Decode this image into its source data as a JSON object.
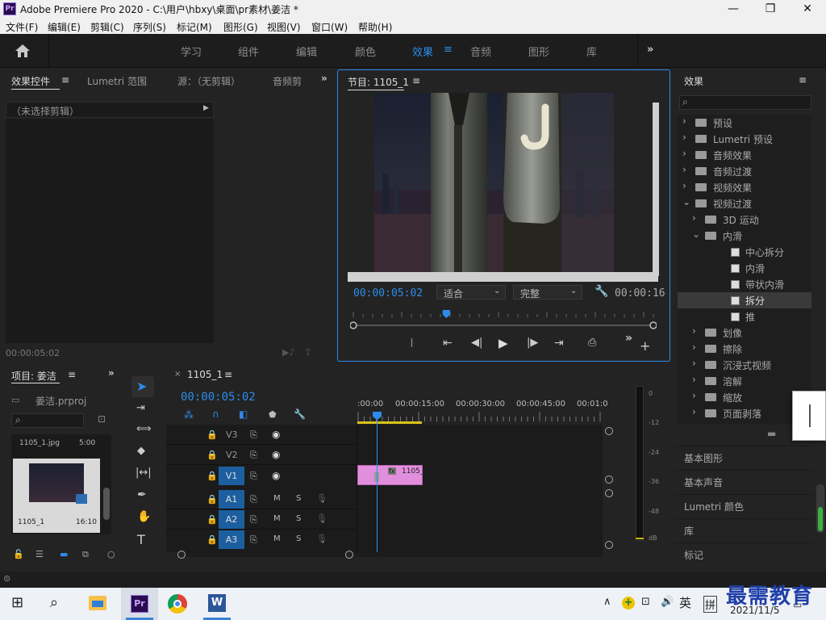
{
  "titlebar": {
    "title": "Adobe Premiere Pro 2020 - C:\\用户\\hbxy\\桌面\\pr素材\\姜洁 *",
    "min": "—",
    "max": "❐",
    "close": "✕"
  },
  "menu": [
    "文件(F)",
    "编辑(E)",
    "剪辑(C)",
    "序列(S)",
    "标记(M)",
    "图形(G)",
    "视图(V)",
    "窗口(W)",
    "帮助(H)"
  ],
  "workspaces": [
    "学习",
    "组件",
    "编辑",
    "颜色",
    "效果",
    "音频",
    "图形",
    "库"
  ],
  "source_panel": {
    "tabs": [
      "效果控件",
      "Lumetri 范围",
      "源：（无剪辑）",
      "音频剪"
    ],
    "no_clip": "（未选择剪辑）",
    "timecode": "00:00:05:02"
  },
  "program": {
    "title": "节目: 1105_1",
    "timecode": "00:00:05:02",
    "fit": "适合",
    "quality": "完整",
    "duration": "00:00:16",
    "playhead_fraction": 0.31
  },
  "project": {
    "title": "项目: 姜洁",
    "file": "姜洁.prproj",
    "clip_name": "1105_1.jpg",
    "clip_dur": "5:00",
    "item_name": "1105_1",
    "item_dur": "16:10"
  },
  "timeline": {
    "tab": "1105_1",
    "timecode": "00:00:05:02",
    "ruler": [
      ":00:00",
      "00:00:15:00",
      "00:00:30:00",
      "00:00:45:00",
      "00:01:0"
    ],
    "video_tracks": [
      "V3",
      "V2",
      "V1"
    ],
    "audio_tracks": [
      "A1",
      "A2",
      "A3"
    ],
    "m": "M",
    "s": "S",
    "clip_label": "1105_"
  },
  "meter": {
    "ticks": [
      "0",
      "-12",
      "-24",
      "-36",
      "-48",
      "dB"
    ]
  },
  "effects": {
    "title": "效果",
    "tree": [
      {
        "label": "预设",
        "depth": 0,
        "icon": "preset"
      },
      {
        "label": "Lumetri 预设",
        "depth": 0,
        "icon": "preset"
      },
      {
        "label": "音频效果",
        "depth": 0,
        "icon": "folder"
      },
      {
        "label": "音频过渡",
        "depth": 0,
        "icon": "folder"
      },
      {
        "label": "视频效果",
        "depth": 0,
        "icon": "folder"
      },
      {
        "label": "视频过渡",
        "depth": 0,
        "icon": "folder",
        "open": true
      },
      {
        "label": "3D 运动",
        "depth": 1,
        "icon": "folder"
      },
      {
        "label": "内滑",
        "depth": 1,
        "icon": "folder",
        "open": true
      },
      {
        "label": "中心拆分",
        "depth": 2,
        "icon": "fx"
      },
      {
        "label": "内滑",
        "depth": 2,
        "icon": "fx"
      },
      {
        "label": "带状内滑",
        "depth": 2,
        "icon": "fx"
      },
      {
        "label": "拆分",
        "depth": 2,
        "icon": "fx",
        "selected": true
      },
      {
        "label": "推",
        "depth": 2,
        "icon": "fx"
      },
      {
        "label": "划像",
        "depth": 1,
        "icon": "folder"
      },
      {
        "label": "擦除",
        "depth": 1,
        "icon": "folder"
      },
      {
        "label": "沉浸式视频",
        "depth": 1,
        "icon": "folder"
      },
      {
        "label": "溶解",
        "depth": 1,
        "icon": "folder"
      },
      {
        "label": "缩放",
        "depth": 1,
        "icon": "folder"
      },
      {
        "label": "页面剥落",
        "depth": 1,
        "icon": "folder"
      }
    ],
    "lower_panels": [
      "基本图形",
      "基本声音",
      "Lumetri 颜色",
      "库",
      "标记"
    ]
  },
  "taskbar": {
    "ime": "英",
    "ime2": "拼",
    "date": "2021/11/5"
  },
  "watermark": "最需教育"
}
